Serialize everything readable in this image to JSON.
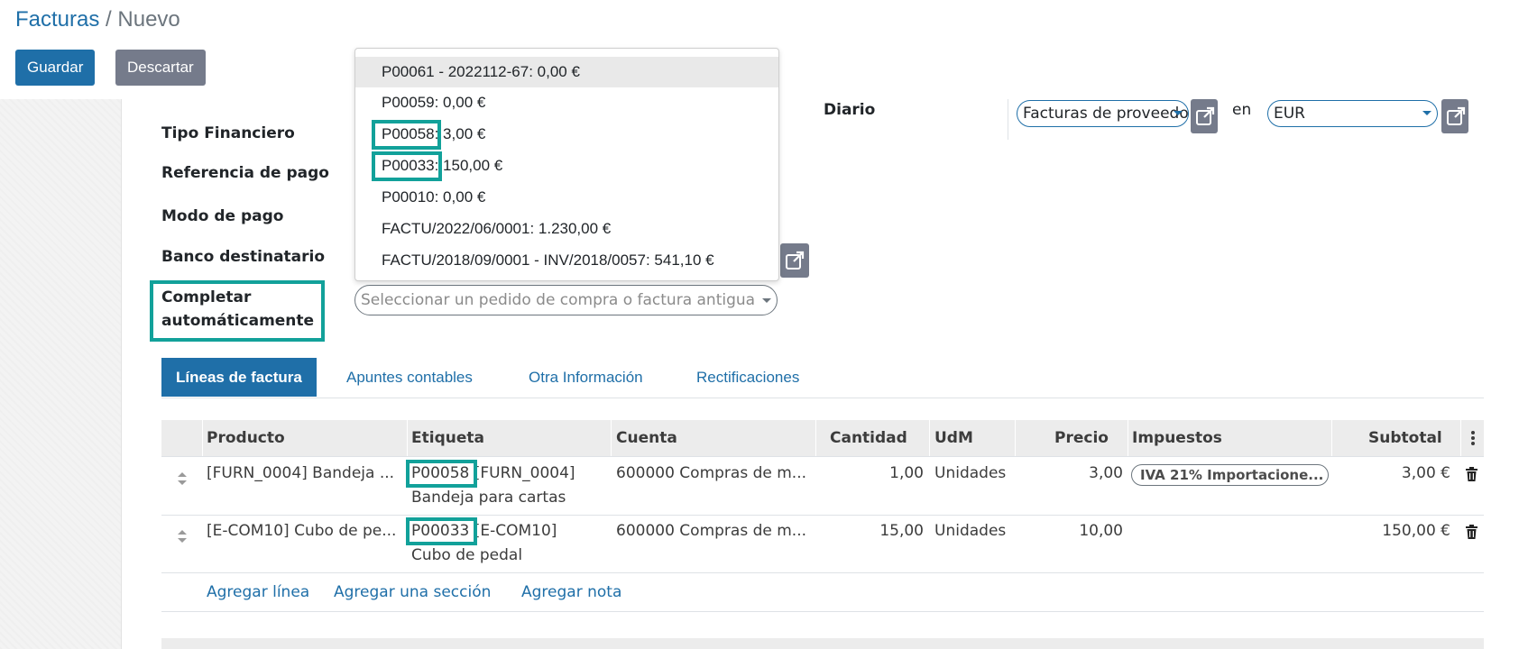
{
  "breadcrumb": {
    "parent": "Facturas",
    "separator": " / ",
    "current": "Nuevo"
  },
  "buttons": {
    "save": "Guardar",
    "discard": "Descartar"
  },
  "form": {
    "labels": {
      "tipo_financiero": "Tipo Financiero",
      "referencia_pago": "Referencia de pago",
      "modo_pago": "Modo de pago",
      "banco_destinatario": "Banco destinatario",
      "completar_1": "Completar",
      "completar_2": "automáticamente",
      "diario": "Diario",
      "en": "en"
    },
    "diario_value": "Facturas de proveedores",
    "currency_value": "EUR",
    "autocomplete_placeholder": "Seleccionar un pedido de compra o factura antigua"
  },
  "dropdown": {
    "items": [
      "P00061 - 2022112-67: 0,00 €",
      "P00059: 0,00 €",
      "P00058: 3,00 €",
      "P00033: 150,00 €",
      "P00010: 0,00 €",
      "FACTU/2022/06/0001: 1.230,00 €",
      "FACTU/2018/09/0001 - INV/2018/0057: 541,10 €"
    ]
  },
  "tabs": [
    "Líneas de factura",
    "Apuntes contables",
    "Otra Información",
    "Rectificaciones"
  ],
  "table": {
    "headers": [
      "Producto",
      "Etiqueta",
      "Cuenta",
      "Cantidad",
      "UdM",
      "Precio",
      "Impuestos",
      "Subtotal"
    ],
    "rows": [
      {
        "producto": "[FURN_0004] Bandeja ...",
        "etiqueta_ref": "P00058",
        "etiqueta_rest": "[FURN_0004]",
        "etiqueta_line2": "Bandeja para cartas",
        "cuenta": "600000 Compras de m...",
        "cantidad": "1,00",
        "udm": "Unidades",
        "precio": "3,00",
        "impuestos": "IVA 21% Importacione...",
        "subtotal": "3,00 €"
      },
      {
        "producto": "[E-COM10] Cubo de pe...",
        "etiqueta_ref": "P00033",
        "etiqueta_rest": "[E-COM10]",
        "etiqueta_line2": "Cubo de pedal",
        "cuenta": "600000 Compras de m...",
        "cantidad": "15,00",
        "udm": "Unidades",
        "precio": "10,00",
        "impuestos": "",
        "subtotal": "150,00 €"
      }
    ],
    "add": {
      "line": "Agregar línea",
      "section": "Agregar una sección",
      "note": "Agregar nota"
    }
  },
  "colors": {
    "primary": "#1f6fa8",
    "secondary": "#757b8b",
    "highlight": "#12a19a"
  },
  "icons": {
    "external": "external-link-icon",
    "trash": "trash-icon",
    "handle": "drag-handle-icon",
    "menu": "kebab-menu-icon"
  }
}
